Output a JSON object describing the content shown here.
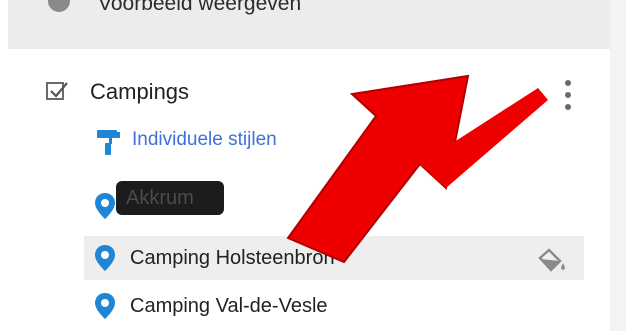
{
  "previous_row": {
    "label": "Voorbeeld weergeven"
  },
  "layer": {
    "title": "Campings",
    "checked": true
  },
  "style_link": {
    "label": "Individuele stijlen"
  },
  "features": [
    {
      "label": "Akkrum"
    },
    {
      "label": "Camping Holsteenbron"
    },
    {
      "label": "Camping Val-de-Vesle"
    }
  ],
  "colors": {
    "pin": "#1f86d6",
    "link": "#3f6fd8",
    "arrow": "#ee0000",
    "selected_row": "#eeeeee"
  },
  "icons": [
    "checkbox-icon",
    "more-vert-icon",
    "paint-roller-icon",
    "map-pin-icon",
    "paint-bucket-icon",
    "annotation-arrow"
  ]
}
